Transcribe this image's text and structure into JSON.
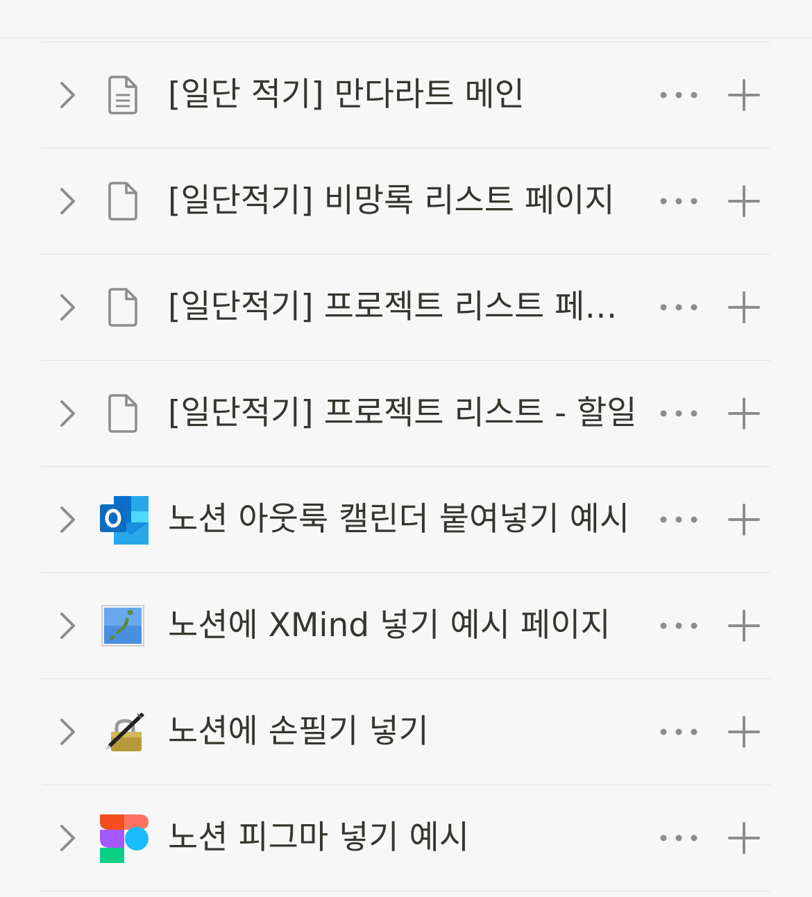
{
  "pages": [
    {
      "title": "[일단 적기] 만다라트 메인",
      "icon": "document-text-icon"
    },
    {
      "title": "[일단적기] 비망록 리스트 페이지",
      "icon": "document-blank-icon"
    },
    {
      "title": "[일단적기] 프로젝트 리스트 페이지",
      "icon": "document-blank-icon"
    },
    {
      "title": "[일단적기] 프로젝트 리스트 - 할일",
      "icon": "document-blank-icon"
    },
    {
      "title": "노션 아웃룩 캘린더 붙여넣기 예시",
      "icon": "outlook-icon"
    },
    {
      "title": "노션에 XMind 넣기 예시 페이지",
      "icon": "japan-map-icon"
    },
    {
      "title": "노션에 손필기 넣기",
      "icon": "locked-pen-icon"
    },
    {
      "title": "노션 피그마 넣기 예시",
      "icon": "figma-icon"
    }
  ],
  "colors": {
    "icon_gray": "#8c8c8c",
    "text": "#37352f",
    "divider": "#e3e3e3",
    "background": "#f7f7f7"
  }
}
